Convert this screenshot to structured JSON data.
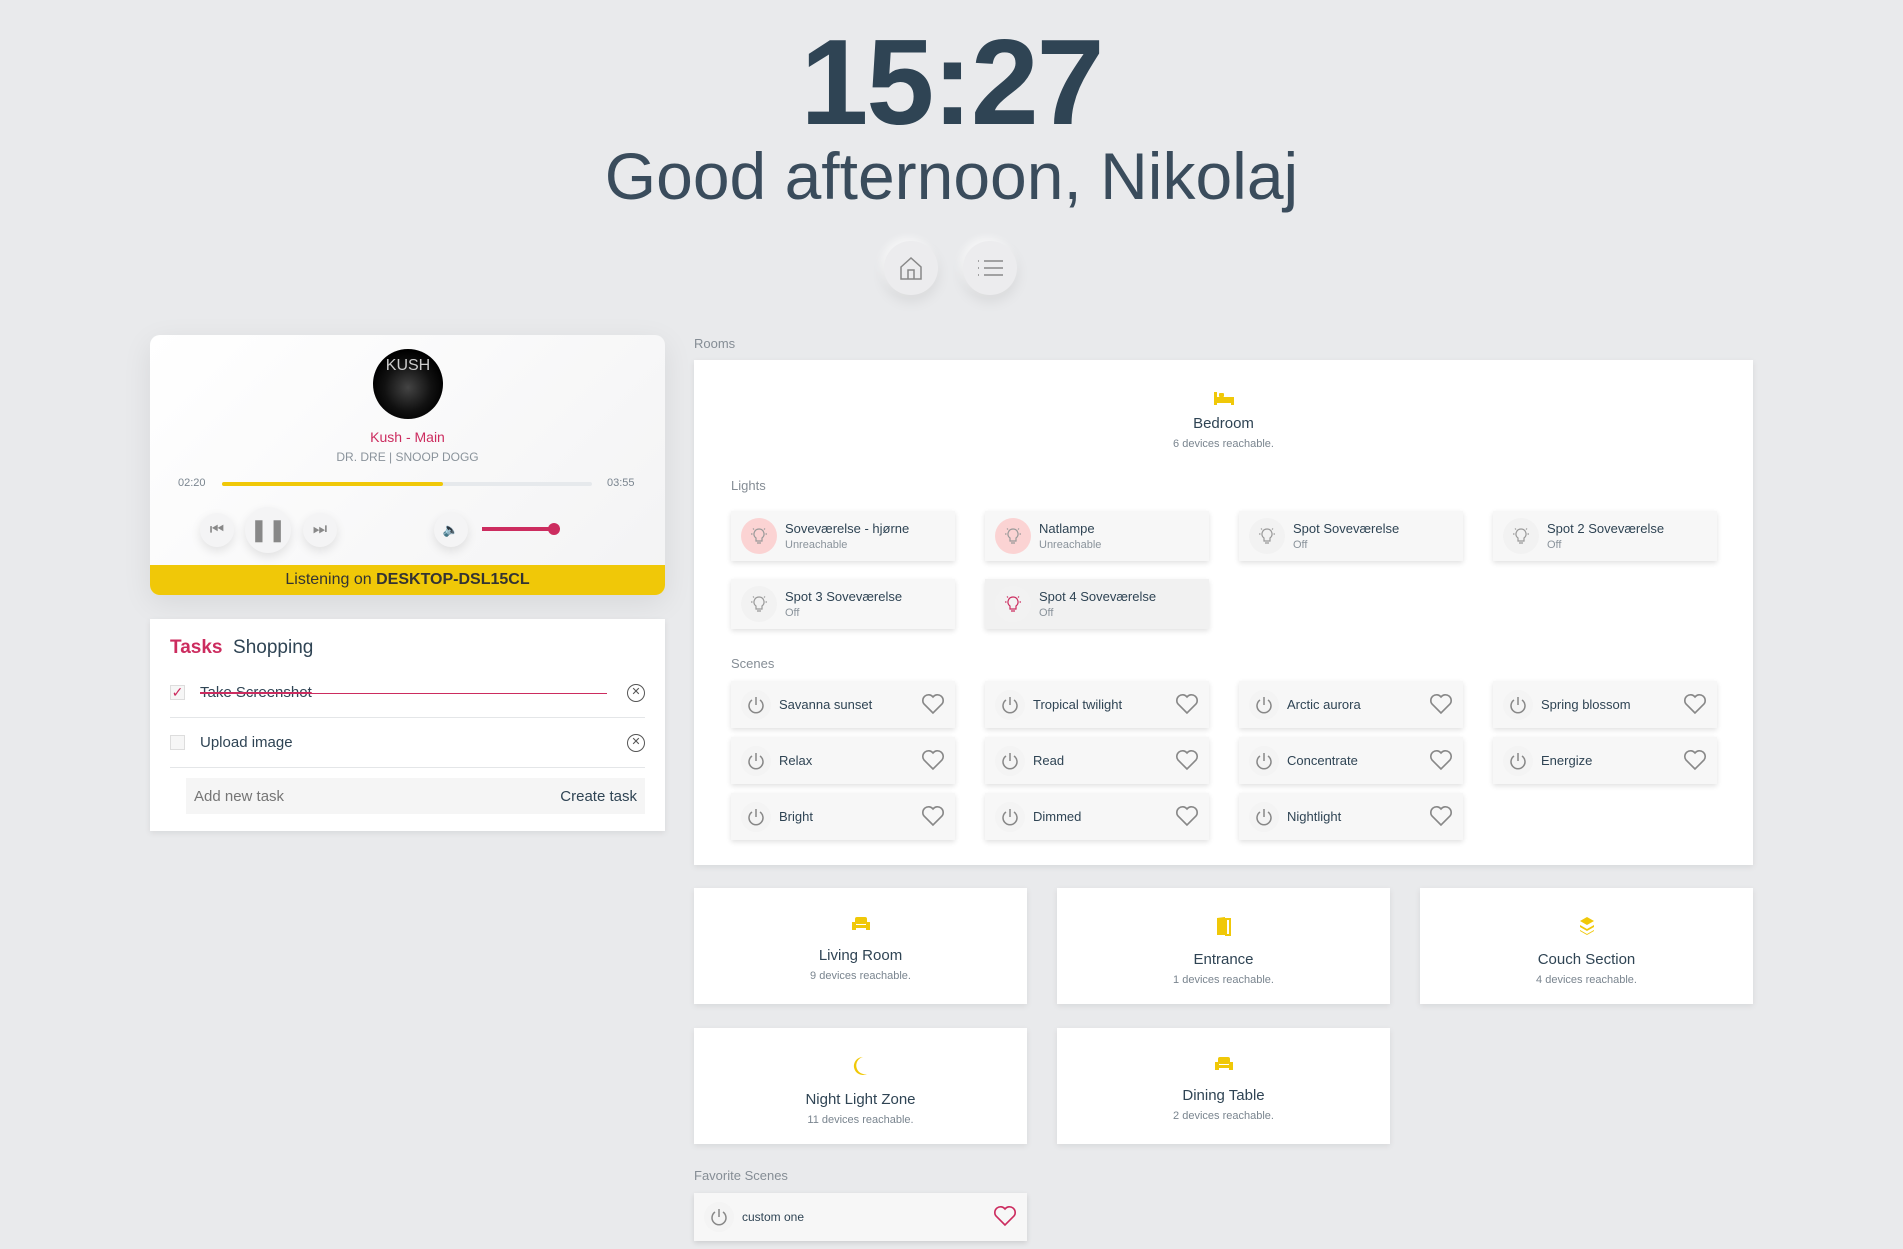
{
  "header": {
    "time": "15:27",
    "greeting": "Good afternoon, Nikolaj"
  },
  "nav": [
    {
      "icon": "home-icon"
    },
    {
      "icon": "list-icon"
    }
  ],
  "player": {
    "album_art_text": "KUSH",
    "title": "Kush - Main",
    "artists": "DR. DRE | SNOOP DOGG",
    "elapsed": "02:20",
    "duration": "03:55",
    "progress": 0.596,
    "volume": 1.0,
    "listening_prefix": "Listening on",
    "device": "DESKTOP-DSL15CL"
  },
  "tasks": {
    "tabs": [
      {
        "label": "Tasks",
        "active": true
      },
      {
        "label": "Shopping",
        "active": false
      }
    ],
    "items": [
      {
        "label": "Take Screenshot",
        "done": true
      },
      {
        "label": "Upload image",
        "done": false
      }
    ],
    "input_placeholder": "Add new task",
    "create_label": "Create task"
  },
  "rooms_label": "Rooms",
  "bedroom": {
    "name": "Bedroom",
    "status": "6 devices reachable.",
    "lights_label": "Lights",
    "scenes_label": "Scenes",
    "lights": [
      {
        "name": "Soveværelse - hjørne",
        "status": "Unreachable",
        "state": "unreachable"
      },
      {
        "name": "Natlampe",
        "status": "Unreachable",
        "state": "unreachable"
      },
      {
        "name": "Spot Soveværelse",
        "status": "Off",
        "state": "off"
      },
      {
        "name": "Spot 2 Soveværelse",
        "status": "Off",
        "state": "off"
      },
      {
        "name": "Spot 3 Soveværelse",
        "status": "Off",
        "state": "off"
      },
      {
        "name": "Spot 4 Soveværelse",
        "status": "Off",
        "state": "selected"
      }
    ],
    "scenes": [
      "Savanna sunset",
      "Tropical twilight",
      "Arctic aurora",
      "Spring blossom",
      "Relax",
      "Read",
      "Concentrate",
      "Energize",
      "Bright",
      "Dimmed",
      "Nightlight"
    ]
  },
  "rooms": [
    {
      "name": "Living Room",
      "status": "9 devices reachable.",
      "icon": "sofa-icon"
    },
    {
      "name": "Entrance",
      "status": "1 devices reachable.",
      "icon": "door-icon"
    },
    {
      "name": "Couch Section",
      "status": "4 devices reachable.",
      "icon": "layers-icon"
    },
    {
      "name": "Night Light Zone",
      "status": "11 devices reachable.",
      "icon": "moon-icon"
    },
    {
      "name": "Dining Table",
      "status": "2 devices reachable.",
      "icon": "sofa-icon"
    }
  ],
  "favorites": {
    "label": "Favorite Scenes",
    "items": [
      {
        "name": "custom one",
        "favorite": true
      }
    ]
  },
  "colors": {
    "accent": "#cc2c5f",
    "yellow": "#f0c808",
    "text": "#2f4454",
    "bg": "#e9eaec"
  }
}
